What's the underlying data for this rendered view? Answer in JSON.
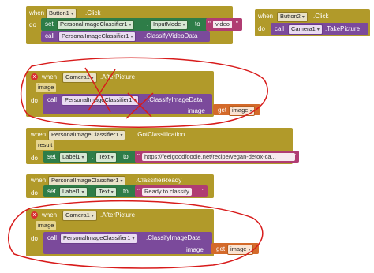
{
  "block_button1_click": {
    "when": "when",
    "component": "Button1",
    "event": ".Click",
    "do": "do",
    "set_kw": "set",
    "set_component": "PersonalImageClassifier1",
    "set_property": "InputMode",
    "to_kw": "to",
    "value": "video",
    "call_kw": "call",
    "call_component": "PersonalImageClassifier1",
    "call_method": ".ClassifyVideoData"
  },
  "block_button2_click": {
    "when": "when",
    "component": "Button2",
    "event": ".Click",
    "do": "do",
    "call_kw": "call",
    "call_component": "Camera1",
    "call_method": ".TakePicture"
  },
  "block_after_picture_1": {
    "error_mark": "x",
    "when": "when",
    "component": "Camera1",
    "event": ".AfterPicture",
    "param": "image",
    "do": "do",
    "call_kw": "call",
    "call_component": "PersonalImageClassifier1",
    "call_method": ".ClassifyImageData",
    "arg_label": "image",
    "get_kw": "get",
    "get_var": "image"
  },
  "block_got_classification": {
    "when": "when",
    "component": "PersonalImageClassifier1",
    "event": ".GotClassification",
    "param": "result",
    "do": "do",
    "set_kw": "set",
    "set_component": "Label1",
    "set_property": "Text",
    "to_kw": "to",
    "value": "https://feelgoodfoodie.net/recipe/vegan-detox-ca..."
  },
  "block_classifier_ready": {
    "when": "when",
    "component": "PersonalImageClassifier1",
    "event": ".ClassifierReady",
    "do": "do",
    "set_kw": "set",
    "set_component": "Label1",
    "set_property": "Text",
    "to_kw": "to",
    "value": "Ready to classify"
  },
  "block_after_picture_2": {
    "error_mark": "x",
    "when": "when",
    "component": "Camera1",
    "event": ".AfterPicture",
    "param": "image",
    "do": "do",
    "call_kw": "call",
    "call_component": "PersonalImageClassifier1",
    "call_method": ".ClassifyImageData",
    "arg_label": "image",
    "get_kw": "get",
    "get_var": "image"
  },
  "colors": {
    "event_block": "#b19a2a",
    "set_block": "#2e7d48",
    "call_block": "#7b4a9b",
    "text_block": "#b03c72",
    "get_block": "#d46a2a",
    "annotation_red": "#d81b1b"
  }
}
